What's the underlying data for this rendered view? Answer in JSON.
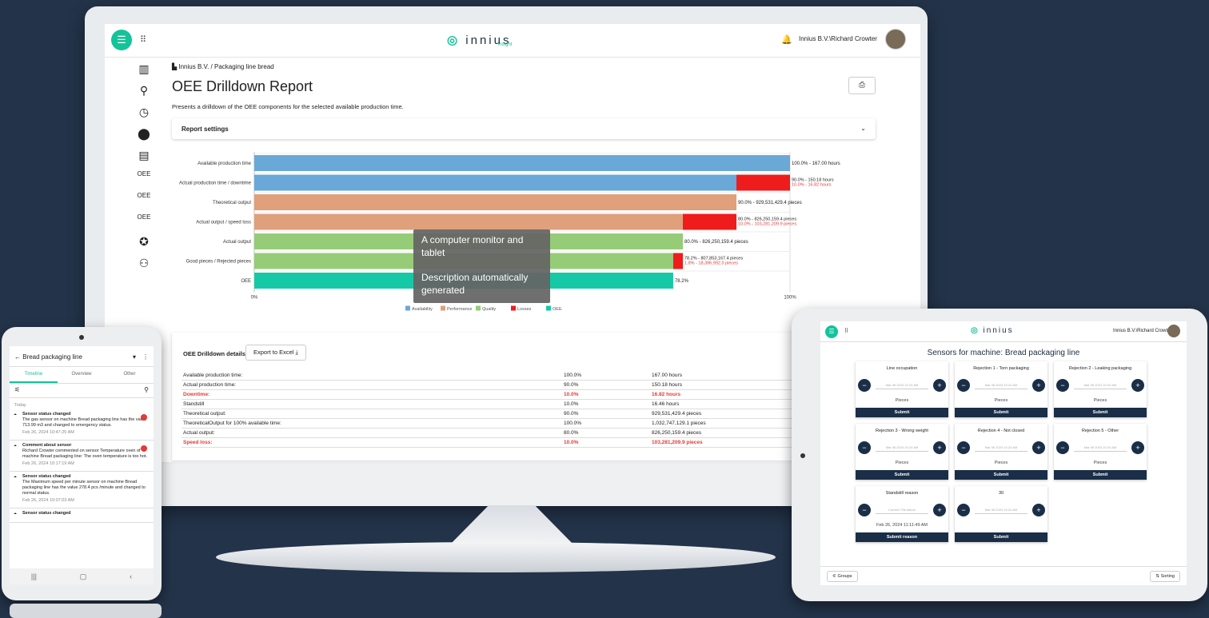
{
  "monitor": {
    "logo": "innius",
    "logo_sub": "insight",
    "user": "Innius B.V.\\Richard Crowter",
    "breadcrumb": "Innius B.V. / Packaging line bread",
    "title": "OEE Drilldown Report",
    "subtitle": "Presents a drilldown of the OEE components for the selected available production time.",
    "report_settings": "Report settings",
    "details_title": "OEE Drilldown details",
    "export_label": "Export to Excel",
    "details": [
      {
        "label": "Available production time:",
        "pct": "100.0%",
        "value": "167.00 hours",
        "red": false
      },
      {
        "label": "Actual production time:",
        "pct": "90.0%",
        "value": "150.18 hours",
        "red": false
      },
      {
        "label": "Downtime:",
        "pct": "10.0%",
        "value": "16.82 hours",
        "red": true
      },
      {
        "label": "Standstill",
        "pct": "10.0%",
        "value": "16.46 hours",
        "red": false
      },
      {
        "label": "Theoretical output:",
        "pct": "90.0%",
        "value": "929,531,429.4 pieces",
        "red": false
      },
      {
        "label": "TheoreticalOutput for 100% available time:",
        "pct": "100.0%",
        "value": "1,032,747,129.1 pieces",
        "red": false
      },
      {
        "label": "Actual output:",
        "pct": "80.0%",
        "value": "826,250,159.4 pieces",
        "red": false
      },
      {
        "label": "Speed loss:",
        "pct": "10.0%",
        "value": "103,281,209.9 pieces",
        "red": true
      }
    ]
  },
  "chart_data": {
    "type": "bar",
    "orientation": "horizontal",
    "stacked": true,
    "xlim": [
      0,
      100
    ],
    "x_ticks": [
      "0%",
      "100%"
    ],
    "categories": [
      "Available production time",
      "Actual production time / downtime",
      "Theoretical output",
      "Actual output / speed loss",
      "Actual output",
      "Good pieces / Rejected pieces",
      "OEE"
    ],
    "series": [
      {
        "name": "Availability",
        "color": "#6aa8d8",
        "values": [
          100,
          90,
          0,
          0,
          0,
          0,
          0
        ]
      },
      {
        "name": "Performance",
        "color": "#dfa07b",
        "values": [
          0,
          0,
          90,
          80,
          0,
          0,
          0
        ]
      },
      {
        "name": "Quality",
        "color": "#96cc78",
        "values": [
          0,
          0,
          0,
          0,
          80,
          78.2,
          0
        ]
      },
      {
        "name": "Losses",
        "color": "#ee1c1c",
        "values": [
          0,
          10,
          0,
          10,
          0,
          1.8,
          0
        ]
      },
      {
        "name": "OEE",
        "color": "#16c9a6",
        "values": [
          0,
          0,
          0,
          0,
          0,
          0,
          78.2
        ]
      }
    ],
    "value_labels": [
      [
        "100.0% - 167.00 hours"
      ],
      [
        "90.0% - 150.18 hours",
        "10.0% - 16.82 hours"
      ],
      [
        "90.0% - 929,531,429.4 pieces"
      ],
      [
        "80.0% - 826,250,159.4 pieces",
        "10.0% - 103,281,209.9 pieces"
      ],
      [
        "80.0% - 826,250,159.4 pieces"
      ],
      [
        "78.2% - 807,853,167.4 pieces",
        "1.8% - 18,396,992.0 pieces"
      ],
      [
        "78.2%"
      ]
    ],
    "legend": [
      "Availability",
      "Performance",
      "Quality",
      "Losses",
      "OEE"
    ],
    "legend_position": "bottom"
  },
  "tooltip": {
    "line1": "A computer monitor and tablet",
    "line2": "Description automatically generated"
  },
  "phone": {
    "title": "Bread packaging line",
    "tabs": [
      "Timeline",
      "Overview",
      "Other"
    ],
    "today": "Today",
    "items": [
      {
        "head": "Sensor status changed",
        "body": "The gas sensor on machine Bread packaging line has the value 713.99 m3 and changed to emergency status.",
        "time": "Feb 26, 2024 10:47:25 AM"
      },
      {
        "head": "Comment about sensor",
        "body": "Richard Crowter commented on sensor Temperature oven of machine Bread packaging line: The oven temperature is too hot.",
        "time": "Feb 26, 2024 10:17:19 AM"
      },
      {
        "head": "Sensor status changed",
        "body": "The Maximum speed per minute sensor on machine Bread packaging line has the value 278.4 pcs /minute and changed to normal status.",
        "time": "Feb 26, 2024 10:07:03 AM"
      },
      {
        "head": "Sensor status changed",
        "body": "",
        "time": ""
      }
    ]
  },
  "tablet": {
    "logo": "innius",
    "user": "Innius B.V.\\Richard Crowter",
    "title": "Sensors for machine: Bread packaging line",
    "tiles": [
      {
        "title": "Line occupation",
        "field": "Mar 06 2024 10:24 AM",
        "unit": "Pieces",
        "submit": "Submit"
      },
      {
        "title": "Rejection 1 - Torn packaging",
        "field": "Mar 06 2024 10:24 AM",
        "unit": "Pieces",
        "submit": "Submit"
      },
      {
        "title": "Rejection 2 - Leaking packaging",
        "field": "Mar 06 2024 10:24 AM",
        "unit": "Pieces",
        "submit": "Submit"
      },
      {
        "title": "Rejection 3 - Wrong weight",
        "field": "Mar 06 2024 10:24 AM",
        "unit": "Pieces",
        "submit": "Submit"
      },
      {
        "title": "Rejection 4 - Not closed",
        "field": "Mar 06 2024 10:24 AM",
        "unit": "Pieces",
        "submit": "Submit"
      },
      {
        "title": "Rejection 5 - Other",
        "field": "Mar 06 2024 10:24 AM",
        "unit": "Pieces",
        "submit": "Submit"
      },
      {
        "title": "Standstill reason",
        "field": "Current: File failure",
        "unit": "Feb 26, 2024 11:11:49 AM",
        "submit": "Submit reason"
      },
      {
        "title": "30",
        "field": "Mar 06 2024 10:24 AM",
        "unit": "",
        "submit": "Submit"
      }
    ],
    "footer_left": "Groups",
    "footer_right": "Sorting"
  }
}
